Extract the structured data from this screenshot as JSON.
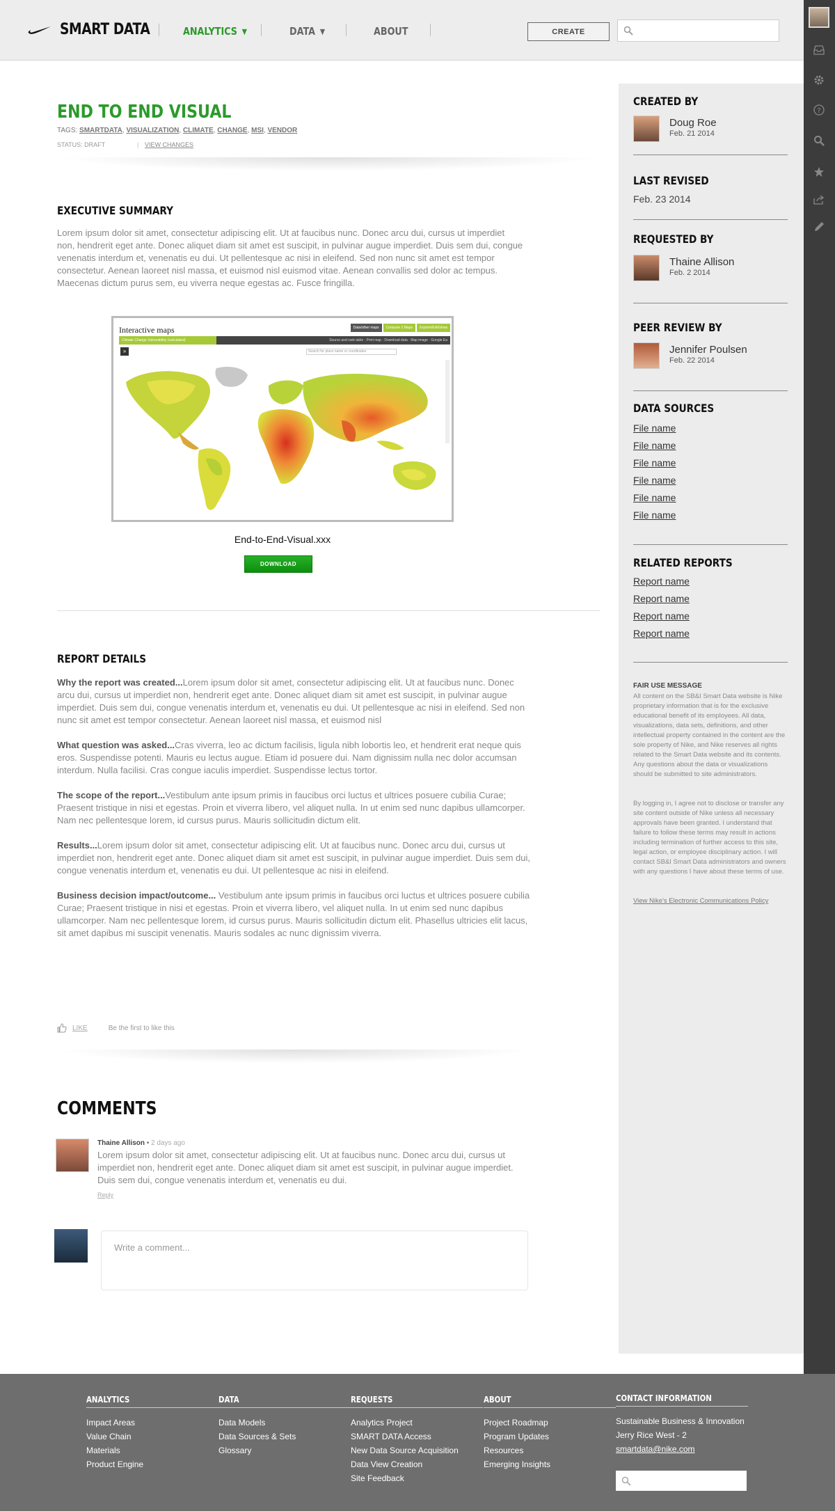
{
  "header": {
    "logo_text": "SMART DATA",
    "nav": [
      {
        "label": "ANALYTICS",
        "has_caret": true
      },
      {
        "label": "DATA",
        "has_caret": true
      },
      {
        "label": "ABOUT",
        "has_caret": false
      }
    ],
    "create_label": "CREATE",
    "search_placeholder": ""
  },
  "doc": {
    "title": "END TO END VISUAL",
    "tags_label": "TAGS:",
    "tags": [
      "SMARTDATA",
      "VISUALIZATION",
      "CLIMATE",
      "CHANGE",
      "MSI",
      "VENDOR"
    ],
    "status": "STATUS: DRAFT",
    "view_changes": "VIEW CHANGES"
  },
  "executive_summary": {
    "heading": "EXECUTIVE SUMMARY",
    "text": "Lorem ipsum dolor sit amet, consectetur adipiscing elit. Ut at faucibus nunc. Donec arcu dui, cursus ut imperdiet non, hendrerit eget ante. Donec aliquet diam sit amet est suscipit, in pulvinar augue imperdiet. Duis sem dui, congue venenatis interdum et, venenatis eu dui. Ut pellentesque ac nisi in eleifend. Sed non nunc sit amet est tempor consectetur. Aenean laoreet nisl massa, et euismod nisl euismod vitae. Aenean convallis sed dolor ac tempus. Maecenas dictum purus sem, eu viverra neque egestas ac. Fusce fringilla."
  },
  "map": {
    "title": "Interactive maps",
    "tabs": [
      "Data/other maps",
      "Compare 2 Maps",
      "Explore/Edit/show"
    ],
    "bar_label": "Climate Change Vulnerability (calculated)",
    "tools": "Source and rank table · Print map · Download data · Map image · Google Ea",
    "search_placeholder": "Search for place name or coordinates"
  },
  "download": {
    "file_name": "End-to-End-Visual.xxx",
    "button_label": "DOWNLOAD"
  },
  "report_details": {
    "heading": "REPORT DETAILS",
    "sections": [
      {
        "lead": "Why the report was created...",
        "text": "Lorem ipsum dolor sit amet, consectetur adipiscing elit. Ut at faucibus nunc. Donec arcu dui, cursus ut imperdiet non, hendrerit eget ante. Donec aliquet diam sit amet est suscipit, in pulvinar augue imperdiet. Duis sem dui, congue venenatis interdum et, venenatis eu dui. Ut pellentesque ac nisi in eleifend. Sed non nunc sit amet est tempor consectetur. Aenean laoreet nisl massa, et euismod nisl"
      },
      {
        "lead": "What question was asked...",
        "text": "Cras viverra, leo ac dictum facilisis, ligula nibh lobortis leo, et hendrerit erat neque quis eros. Suspendisse potenti. Mauris eu lectus augue. Etiam id posuere dui. Nam dignissim nulla nec dolor accumsan interdum. Nulla facilisi. Cras congue iaculis imperdiet. Suspendisse lectus tortor."
      },
      {
        "lead": "The scope of the report...",
        "text": "Vestibulum ante ipsum primis in faucibus orci luctus et ultrices posuere cubilia Curae; Praesent tristique in nisi et egestas. Proin et viverra libero, vel aliquet nulla. In ut enim sed nunc dapibus ullamcorper. Nam nec pellentesque lorem, id cursus purus. Mauris sollicitudin dictum elit."
      },
      {
        "lead": "Results...",
        "text": "Lorem ipsum dolor sit amet, consectetur adipiscing elit. Ut at faucibus nunc. Donec arcu dui, cursus ut imperdiet non, hendrerit eget ante. Donec aliquet diam sit amet est suscipit, in pulvinar augue imperdiet. Duis sem dui, congue venenatis interdum et, venenatis eu dui. Ut pellentesque ac nisi in eleifend."
      },
      {
        "lead": "Business decision impact/outcome...",
        "text": " Vestibulum ante ipsum primis in faucibus orci luctus et ultrices posuere cubilia Curae; Praesent tristique in nisi et egestas. Proin et viverra libero, vel aliquet nulla. In ut enim sed nunc dapibus ullamcorper. Nam nec pellentesque lorem, id cursus purus. Mauris sollicitudin dictum elit. Phasellus ultricies elit lacus, sit amet dapibus mi suscipit venenatis. Mauris sodales ac nunc dignissim viverra."
      }
    ]
  },
  "like": {
    "label": "LIKE",
    "note": "Be the first to like this"
  },
  "comments": {
    "heading": "COMMENTS",
    "items": [
      {
        "author": "Thaine Allison",
        "time": "2 days ago",
        "text": "Lorem ipsum dolor sit amet, consectetur adipiscing elit. Ut at faucibus nunc. Donec arcu dui, cursus ut imperdiet non, hendrerit eget ante. Donec aliquet diam sit amet est suscipit, in pulvinar augue imperdiet. Duis sem dui, congue venenatis interdum et, venenatis eu dui.",
        "reply_label": "Reply"
      }
    ],
    "input_placeholder": "Write a comment..."
  },
  "sidebar": {
    "created_by": {
      "heading": "CREATED BY",
      "name": "Doug Roe",
      "date": "Feb. 21 2014"
    },
    "last_revised": {
      "heading": "LAST REVISED",
      "date": "Feb. 23 2014"
    },
    "requested_by": {
      "heading": "REQUESTED BY",
      "name": "Thaine Allison",
      "date": "Feb. 2 2014"
    },
    "peer_review_by": {
      "heading": "PEER REVIEW BY",
      "name": "Jennifer Poulsen",
      "date": "Feb. 22 2014"
    },
    "data_sources": {
      "heading": "DATA SOURCES",
      "items": [
        "File name",
        "File name",
        "File name",
        "File name",
        "File name",
        "File name"
      ]
    },
    "related_reports": {
      "heading": "RELATED REPORTS",
      "items": [
        "Report name",
        "Report name",
        "Report name",
        "Report name"
      ]
    },
    "fair_use": {
      "heading": "FAIR USE MESSAGE",
      "p1": "All content on the SB&I Smart Data website is Nike proprietary information that is for the exclusive educational benefit of its employees. All data, visualizations, data sets, definitions, and other intellectual property contained in the content are the sole property of Nike, and Nike reserves all rights related to the Smart Data website and its contents. Any questions about the data or visualizations should be submitted to site administrators.",
      "p2": "By logging in, I agree not to disclose or transfer any site content outside of Nike unless all necessary approvals have been granted. I understand that failure to follow these terms may result in actions including termination of further access to this site, legal action, or employee disciplinary action. I will contact SB&I Smart Data administrators and owners with any questions I have about these terms of use.",
      "link": "View Nike's Electronic Communications Policy"
    }
  },
  "footer": {
    "columns": [
      {
        "heading": "ANALYTICS",
        "items": [
          "Impact Areas",
          "Value Chain",
          "Materials",
          "Product Engine"
        ]
      },
      {
        "heading": "DATA",
        "items": [
          "Data Models",
          "Data Sources & Sets",
          "Glossary"
        ]
      },
      {
        "heading": "REQUESTS",
        "items": [
          "Analytics Project",
          "SMART DATA Access",
          "New Data Source Acquisition",
          "Data View Creation",
          "Site Feedback"
        ]
      },
      {
        "heading": "ABOUT",
        "items": [
          "Project Roadmap",
          "Program Updates",
          "Resources",
          "Emerging Insights"
        ]
      }
    ],
    "contact": {
      "heading": "CONTACT INFORMATION",
      "lines": [
        "Sustainable Business & Innovation",
        "Jerry Rice West - 2"
      ],
      "email": "smartdata@nike.com"
    }
  }
}
